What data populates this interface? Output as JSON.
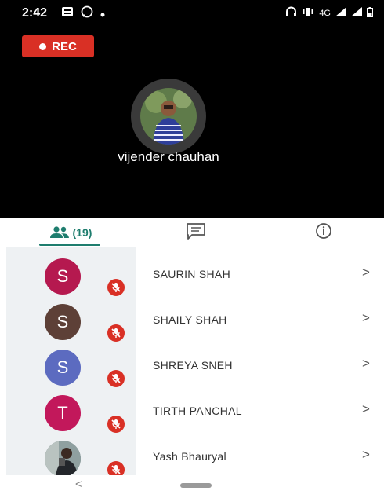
{
  "status_bar": {
    "time": "2:42",
    "network": "4G"
  },
  "recording": {
    "label": "REC"
  },
  "active_speaker": {
    "name": "vijender chauhan"
  },
  "tabs": {
    "people_count": "(19)"
  },
  "participants": [
    {
      "initial": "S",
      "name": "SAURIN SHAH",
      "avatar_color": "#b5194f"
    },
    {
      "initial": "S",
      "name": "SHAILY SHAH",
      "avatar_color": "#5d4037"
    },
    {
      "initial": "S",
      "name": "SHREYA SNEH",
      "avatar_color": "#5c6bc0"
    },
    {
      "initial": "T",
      "name": "TIRTH PANCHAL",
      "avatar_color": "#c2185b"
    },
    {
      "initial": "",
      "name": "Yash Bhauryal",
      "avatar_color": "#7a8b8c"
    }
  ],
  "chevron": ">",
  "nav": {
    "back": "<"
  },
  "colors": {
    "accent": "#1e7d6e",
    "rec": "#d93025"
  }
}
